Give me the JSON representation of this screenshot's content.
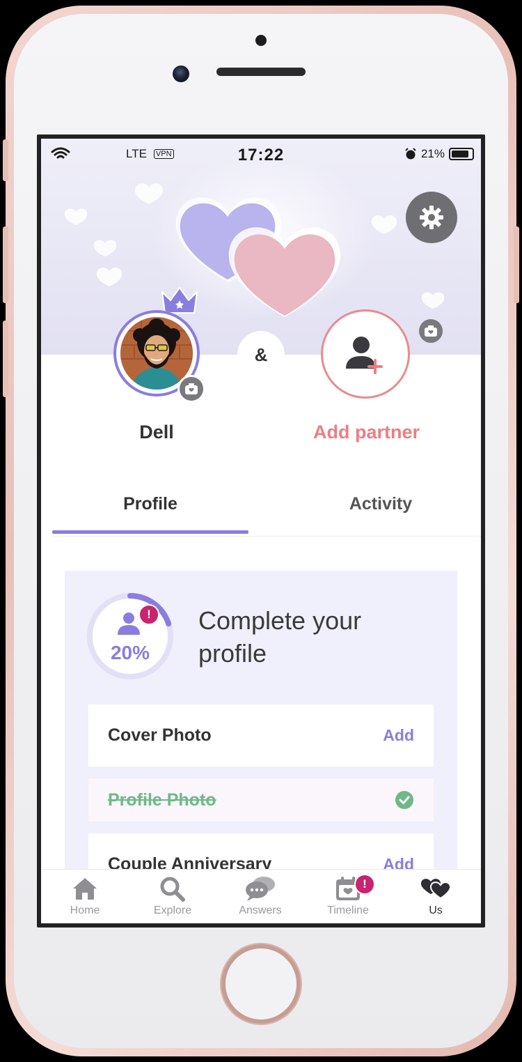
{
  "status_bar": {
    "network": "LTE",
    "vpn": "VPN",
    "time": "17:22",
    "battery": "21%"
  },
  "profile": {
    "user_name": "Dell",
    "connector": "&",
    "partner_label": "Add partner"
  },
  "tabs": [
    {
      "label": "Profile",
      "active": true
    },
    {
      "label": "Activity",
      "active": false
    }
  ],
  "completion": {
    "percent_label": "20%",
    "percent_value": 0.2,
    "badge": "!",
    "title": "Complete your profile",
    "tasks": [
      {
        "label": "Cover Photo",
        "action": "Add",
        "done": false
      },
      {
        "label": "Profile Photo",
        "done": true
      },
      {
        "label": "Couple Anniversary",
        "action": "Add",
        "done": false
      }
    ]
  },
  "bottom_nav": [
    {
      "label": "Home",
      "icon": "home-icon"
    },
    {
      "label": "Explore",
      "icon": "search-icon"
    },
    {
      "label": "Answers",
      "icon": "chat-bubbles-icon"
    },
    {
      "label": "Timeline",
      "icon": "calendar-heart-icon",
      "badge": "!"
    },
    {
      "label": "Us",
      "icon": "hearts-icon",
      "active": true
    }
  ],
  "colors": {
    "accent": "#8a7de0",
    "partner": "#ec7e82",
    "done": "#6fb88a",
    "badge": "#c8246f"
  }
}
